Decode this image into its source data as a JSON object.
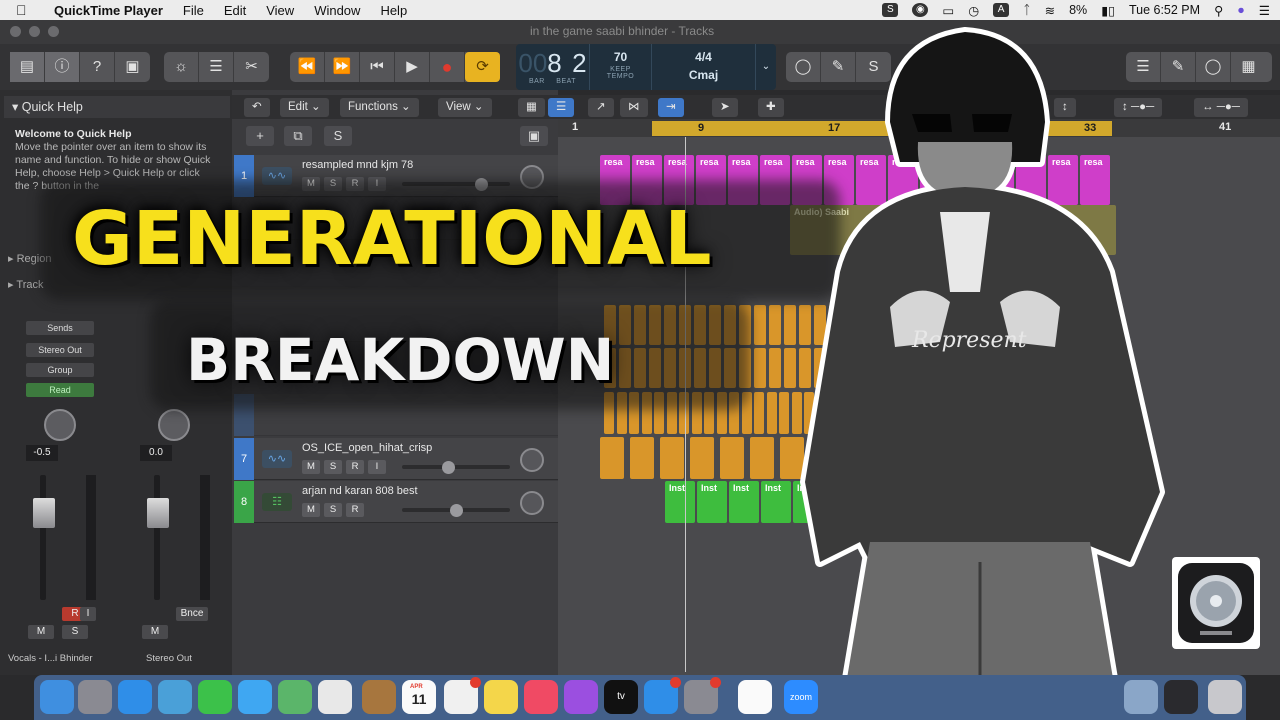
{
  "menubar": {
    "app": "QuickTime Player",
    "items": [
      "File",
      "Edit",
      "View",
      "Window",
      "Help"
    ],
    "battery": "8%",
    "clock": "Tue 6:52 PM"
  },
  "window": {
    "title": "in the game saabi bhinder - Tracks"
  },
  "lcd": {
    "bar": "8",
    "beat": "2",
    "bar_label": "BAR",
    "beat_label": "BEAT",
    "tempo": "70",
    "tempo_mode": "KEEP",
    "tempo_label": "TEMPO",
    "time_sig": "4/4",
    "key": "Cmaj"
  },
  "quick_help": {
    "title": "Quick Help",
    "heading": "Welcome to Quick Help",
    "body": "Move the pointer over an item to show its name and function. To hide or show Quick Help, choose Help > Quick Help or click the ? button in the"
  },
  "inspector": {
    "region": "Region",
    "track": "Track",
    "sends": "Sends"
  },
  "strips": [
    {
      "output": "Stereo Out",
      "group": "Group",
      "automation": "Read",
      "volume": "-0.5",
      "name": "Vocals - I...i Bhinder",
      "mute": "M",
      "solo": "S",
      "rec": "R",
      "input": "I"
    },
    {
      "output": "",
      "group": "",
      "automation": "",
      "volume": "0.0",
      "name": "Stereo Out",
      "mute": "M",
      "bounce": "Bnce"
    }
  ],
  "tracks_toolbar": {
    "edit": "Edit",
    "functions": "Functions",
    "view": "View"
  },
  "tracks": [
    {
      "num": "1",
      "name": "resampled mnd kjm 78",
      "buttons": [
        "M",
        "S",
        "R",
        "I"
      ],
      "volume": 0.73
    },
    {
      "num": "7",
      "name": "OS_ICE_open_hihat_crisp",
      "buttons": [
        "M",
        "S",
        "R",
        "I"
      ],
      "volume": 0.43
    },
    {
      "num": "8",
      "name": "arjan nd karan 808 best",
      "buttons": [
        "M",
        "S",
        "R"
      ],
      "volume": 0.5
    }
  ],
  "ruler": {
    "marks": [
      "1",
      "9",
      "17",
      "33",
      "41"
    ]
  },
  "region_labels": {
    "resampled": "resa",
    "audio": "Audio) Saabi",
    "inst": "Inst"
  },
  "overlay": {
    "line1": "GENERATIONAL",
    "line2": "BREAKDOWN"
  },
  "shirt_text": "Represent",
  "dock": {
    "calendar_day": "11",
    "calendar_month": "APR",
    "zoom": "zoom",
    "tv": "tv"
  },
  "colors": {
    "headline": "#f7e01c",
    "cycle": "#d2a82c",
    "audio_region": "#cf3ec9",
    "midi_region": "#3ebd3e",
    "drum_region": "#d9962a"
  }
}
